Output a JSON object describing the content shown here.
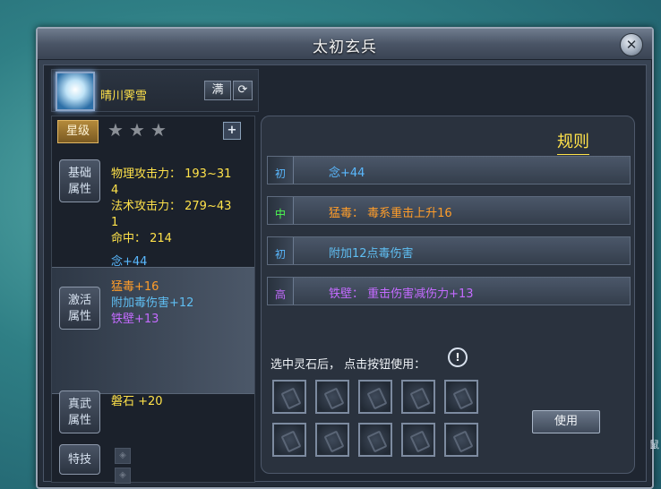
{
  "window": {
    "title": "太初玄兵",
    "close_label": "✕"
  },
  "weapon": {
    "name": "晴川霁雪",
    "full_label": "满",
    "refresh_label": "⟳"
  },
  "stars": {
    "label": "星级",
    "count": 3,
    "filled": 0,
    "plus_label": "+"
  },
  "sections": {
    "base": {
      "label_line1": "基础",
      "label_line2": "属性",
      "lines": [
        "物理攻击力： 193~31",
        "4",
        "法术攻击力： 279~43",
        "1",
        "命中： 214"
      ]
    },
    "activate": {
      "label_line1": "激活",
      "label_line2": "属性",
      "lines": [
        "念+44",
        "猛毒+16",
        "附加毒伤害+12",
        "铁壁+13"
      ]
    },
    "zhenwu": {
      "label_line1": "真武",
      "label_line2": "属性",
      "lines": [
        "磐石 +20"
      ]
    },
    "skill": {
      "label": "特技"
    }
  },
  "rules": {
    "title": "规则",
    "rows": [
      {
        "tag": "初",
        "text": "念+44"
      },
      {
        "tag": "中",
        "text": "猛毒： 毒系重击上升16"
      },
      {
        "tag": "初",
        "text": "附加12点毒伤害"
      },
      {
        "tag": "高",
        "text": "铁壁： 重击伤害减伤力+13"
      }
    ]
  },
  "stones": {
    "hint": "选中灵石后， 点击按钮使用：",
    "info_label": "!",
    "use_label": "使用",
    "slot_count": 10
  },
  "side": {
    "text": "鼠"
  },
  "colors": {
    "yellow": "#ffe24a",
    "blue": "#5ab9ff",
    "orange": "#ff9d2a",
    "green": "#4dff52",
    "purple": "#c46bff"
  }
}
